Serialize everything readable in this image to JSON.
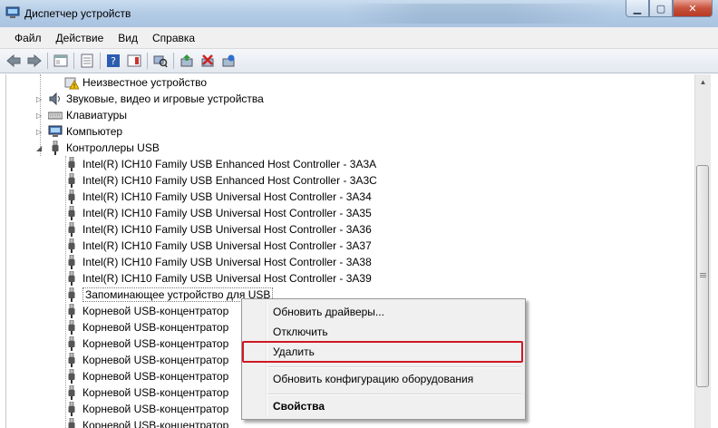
{
  "window": {
    "title": "Диспетчер устройств"
  },
  "menu": [
    "Файл",
    "Действие",
    "Вид",
    "Справка"
  ],
  "tree": {
    "items": [
      {
        "label": "Неизвестное устройство",
        "icon": "unknown-device-icon",
        "level": 2
      },
      {
        "label": "Звуковые, видео и игровые устройства",
        "icon": "sound-icon",
        "level": 1
      },
      {
        "label": "Клавиатуры",
        "icon": "keyboard-icon",
        "level": 1
      },
      {
        "label": "Компьютер",
        "icon": "computer-icon",
        "level": 1
      },
      {
        "label": "Контроллеры USB",
        "icon": "usb-icon",
        "level": 1
      },
      {
        "label": "Intel(R) ICH10 Family USB Enhanced Host Controller - 3A3A",
        "icon": "usb-icon",
        "level": 2
      },
      {
        "label": "Intel(R) ICH10 Family USB Enhanced Host Controller - 3A3C",
        "icon": "usb-icon",
        "level": 2
      },
      {
        "label": "Intel(R) ICH10 Family USB Universal Host Controller - 3A34",
        "icon": "usb-icon",
        "level": 2
      },
      {
        "label": "Intel(R) ICH10 Family USB Universal Host Controller - 3A35",
        "icon": "usb-icon",
        "level": 2
      },
      {
        "label": "Intel(R) ICH10 Family USB Universal Host Controller - 3A36",
        "icon": "usb-icon",
        "level": 2
      },
      {
        "label": "Intel(R) ICH10 Family USB Universal Host Controller - 3A37",
        "icon": "usb-icon",
        "level": 2
      },
      {
        "label": "Intel(R) ICH10 Family USB Universal Host Controller - 3A38",
        "icon": "usb-icon",
        "level": 2
      },
      {
        "label": "Intel(R) ICH10 Family USB Universal Host Controller - 3A39",
        "icon": "usb-icon",
        "level": 2
      },
      {
        "label": "Запоминающее устройство для USB",
        "icon": "usb-icon",
        "level": 2,
        "selected": true
      },
      {
        "label": "Корневой USB-концентратор",
        "icon": "usb-icon",
        "level": 2
      },
      {
        "label": "Корневой USB-концентратор",
        "icon": "usb-icon",
        "level": 2
      },
      {
        "label": "Корневой USB-концентратор",
        "icon": "usb-icon",
        "level": 2
      },
      {
        "label": "Корневой USB-концентратор",
        "icon": "usb-icon",
        "level": 2
      },
      {
        "label": "Корневой USB-концентратор",
        "icon": "usb-icon",
        "level": 2
      },
      {
        "label": "Корневой USB-концентратор",
        "icon": "usb-icon",
        "level": 2
      },
      {
        "label": "Корневой USB-концентратор",
        "icon": "usb-icon",
        "level": 2
      },
      {
        "label": "Корневой USB-концентратор",
        "icon": "usb-icon",
        "level": 2
      }
    ]
  },
  "context_menu": {
    "items": [
      {
        "label": "Обновить драйверы...",
        "bold": false
      },
      {
        "label": "Отключить",
        "bold": false
      },
      {
        "label": "Удалить",
        "bold": false,
        "highlighted": true
      },
      {
        "label": "Обновить конфигурацию оборудования",
        "bold": false
      },
      {
        "label": "Свойства",
        "bold": true
      }
    ]
  },
  "colors": {
    "highlight_border": "#d01824",
    "titlebar": "#b3cbe5"
  }
}
